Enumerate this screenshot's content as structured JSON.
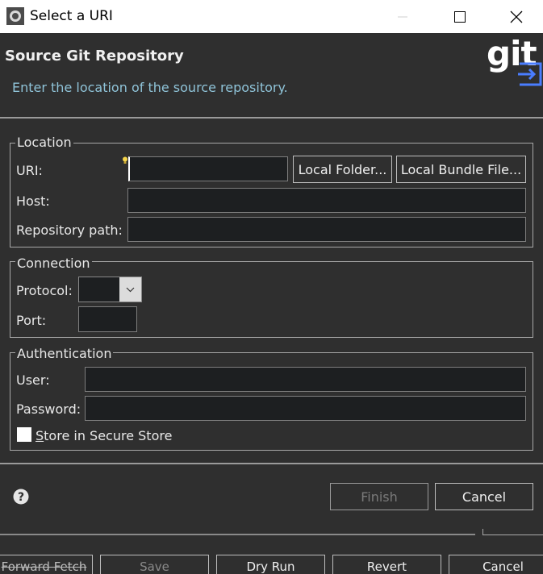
{
  "window": {
    "title": "Select a URI"
  },
  "header": {
    "title": "Source Git Repository",
    "description": "Enter the location of the source repository.",
    "logo_text": "git"
  },
  "location": {
    "legend": "Location",
    "uri_label": "URI:",
    "uri_value": "",
    "local_folder_button": "Local Folder...",
    "local_bundle_button": "Local Bundle File...",
    "host_label": "Host:",
    "host_value": "",
    "repo_path_label": "Repository path:",
    "repo_path_value": ""
  },
  "connection": {
    "legend": "Connection",
    "protocol_label": "Protocol:",
    "protocol_value": "",
    "port_label": "Port:",
    "port_value": ""
  },
  "authentication": {
    "legend": "Authentication",
    "user_label": "User:",
    "user_value": "",
    "password_label": "Password:",
    "password_value": "",
    "store_label_first": "S",
    "store_label_rest": "tore in Secure Store",
    "store_checked": false
  },
  "footer": {
    "finish_button": "Finish",
    "cancel_button": "Cancel"
  },
  "background_window": {
    "buttons": [
      "Forward Fetch",
      "Save",
      "Dry Run",
      "Revert",
      "Cancel"
    ]
  },
  "colors": {
    "background": "#2f2f2f",
    "field": "#1d1f21",
    "accent_blue": "#4a7dff",
    "description": "#8fc3d8"
  }
}
